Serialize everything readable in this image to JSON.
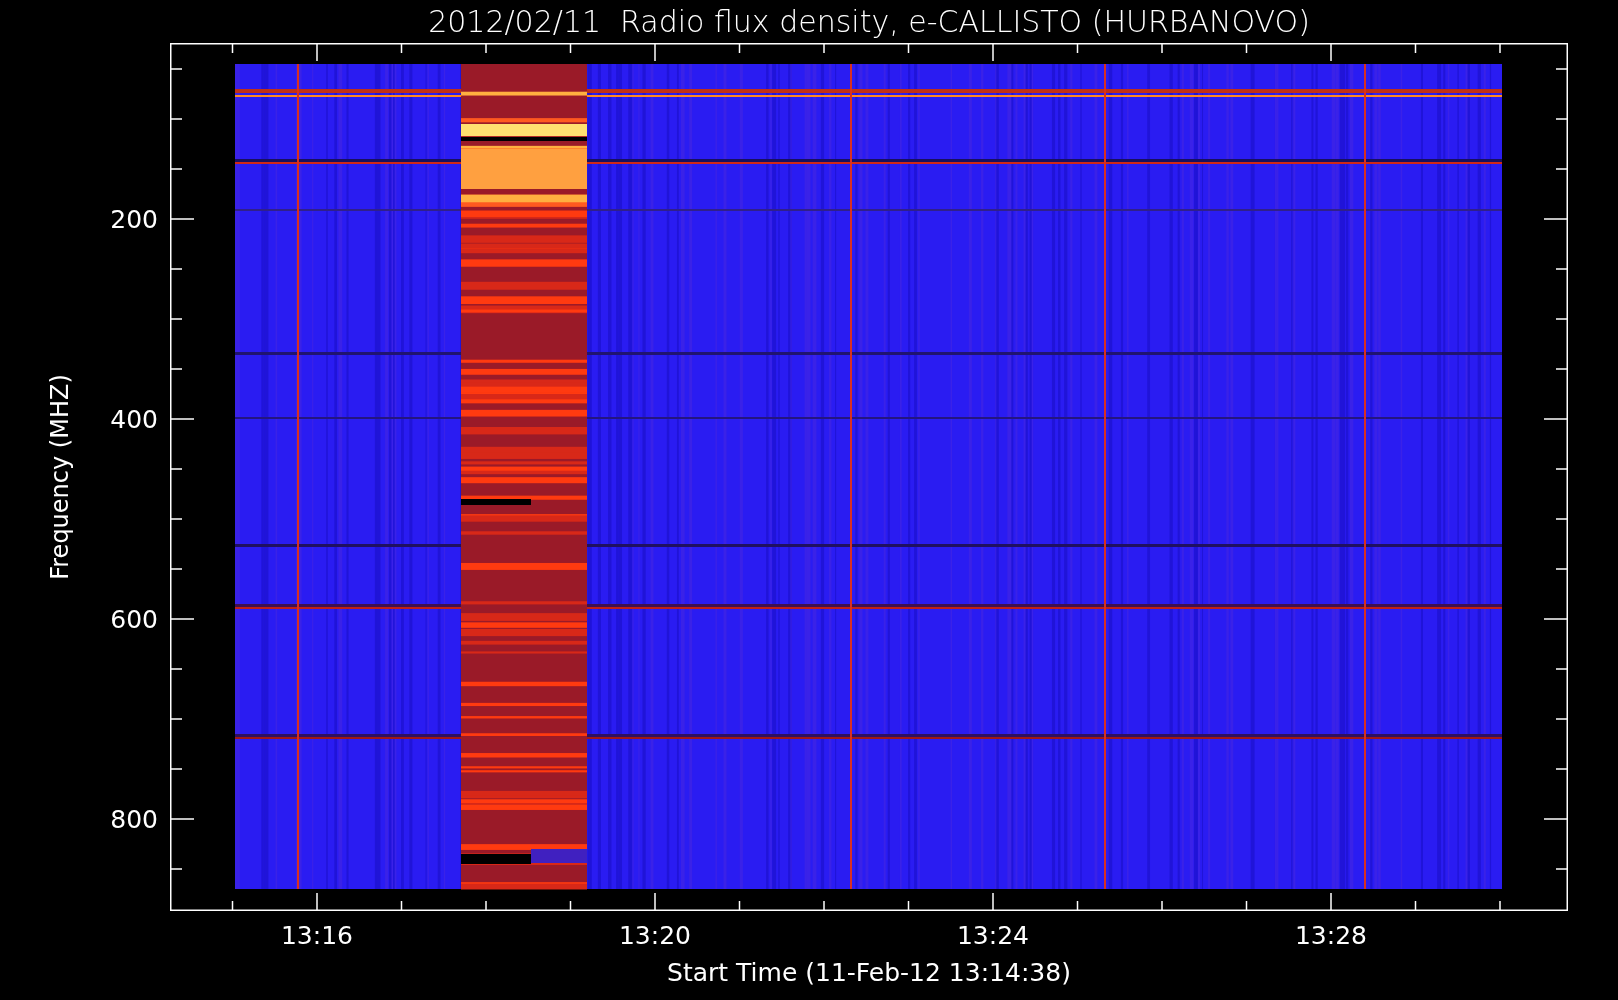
{
  "title": "2012/02/11  Radio flux density, e-CALLISTO (HURBANOVO)",
  "y_axis": {
    "label": "Frequency (MHZ)",
    "ticks": [
      "200",
      "400",
      "600",
      "800"
    ]
  },
  "x_axis": {
    "label": "Start Time (11-Feb-12 13:14:38)",
    "ticks": [
      "13:16",
      "13:20",
      "13:24",
      "13:28"
    ]
  }
}
